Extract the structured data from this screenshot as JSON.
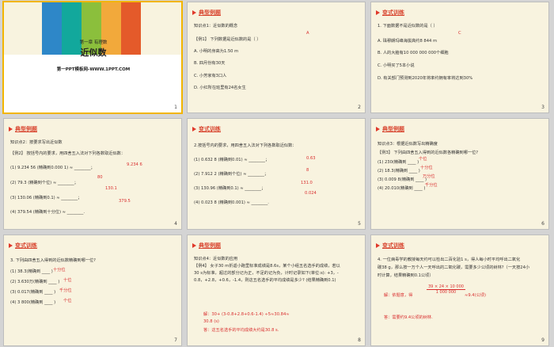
{
  "slides": [
    {
      "num": "1",
      "chapter": "第一章  有理数",
      "title": "近似数",
      "logo": "第一PPT模板网-WWW.1PPT.COM",
      "stripe_colors": [
        "#2e87c8",
        "#12a89c",
        "#8bbf3c",
        "#f2a93b",
        "#e45a2a"
      ]
    },
    {
      "num": "2",
      "header": "典型例题",
      "lines": [
        "知识点1：近似数的概念",
        "【例1】 下列数据是近似数的是（    ）",
        "A. 小明的身高为1.50 m",
        "B. 四月份有30天",
        "C. 小芳家有3口人",
        "D. 小红所在班里有24名女生"
      ],
      "answer": "A"
    },
    {
      "num": "3",
      "header": "变式训练",
      "lines": [
        "1. 下面数据不是近似数的是（    ）",
        "A. 珠穆朗玛峰海拔高约8 844 m",
        "B. 人的大脑有10 000 000 000个细胞",
        "C. 小明买了5本小说",
        "D. 有关部门预测到2020年将率约拥有率将达到30%"
      ],
      "answer": "C"
    },
    {
      "num": "4",
      "header": "典型例题",
      "lines": [
        "知识点2：按要求写出近似数",
        "【例2】 按括号内的要求，用四舍五入法对下列各数取近似数：",
        "(1) 9.234 56 (精确到0.000 1) ≈ ________；",
        "(2) 79.3 (精确到个位) ≈ ________；",
        "(3) 130.06 (精确到0.1) ≈ ________；",
        "(4) 379.54 (精确到十分位) ≈ ________."
      ],
      "answers": [
        "9.234 6",
        "80",
        "130.1",
        "379.5"
      ]
    },
    {
      "num": "5",
      "header": "变式训练",
      "lines": [
        "2.按括号内的要求，用四舍五入法对下列各数取近似数：",
        "(1) 0.632 8 (精确到0.01) ≈ ________；",
        "(2) 7.912 2 (精确到个位) ≈ ________；",
        "(3) 130.96 (精确到0.1) ≈ ________；",
        "(4) 0.023 8 (精确到0.001) ≈ ________."
      ],
      "answers": [
        "0.63",
        "8",
        "131.0",
        "0.024"
      ]
    },
    {
      "num": "6",
      "header": "典型例题",
      "lines": [
        "知识点3：根据近似数写出精确度",
        "【例3】 下列由四舍五入得到的近似数各精确到哪一位?",
        "(1) 230(精确到 ____ )",
        "(2) 18.3(精确到 ____ )",
        "(3) 0.009 8(精确到 ____ )",
        "(4) 20.010(精确到 ____ )"
      ],
      "answers": [
        "个位",
        "十分位",
        "万分位",
        "千分位"
      ]
    },
    {
      "num": "7",
      "header": "变式训练",
      "lines": [
        "3. 下列由四舍五入得到的近似数精确到哪一位?",
        "(1) 38.3(精确到 ____ )",
        "(2) 3.630万(精确到 ____ )",
        "(3) 0.017(精确到 ____ )",
        "(4) 3 800(精确到 ____ )"
      ],
      "answers": [
        "十分位",
        "十位",
        "千分位",
        "个位"
      ]
    },
    {
      "num": "8",
      "header": "典型例题",
      "lines": [
        "知识点4：近似数的应用",
        "【例4】 女子30 m折返小跑里标准成绩是8.6s，某个小组五名选手的成绩，若以",
        "30 s为标准，超过的部分记为正，不足的记为负，计时记录如下(单位:s): +3，-",
        "0.8，+2.8，+0.6，-1.4，则这五名选手的平均成绩是多少? (结果精确到0.1)"
      ],
      "solution": [
        "解：30+ (3-0.8+2.8+0.6-1.4) ÷5≈30.84≈",
        "30.8 (s)",
        "答：这五名选手的平均成绩大约是30.8 s."
      ]
    },
    {
      "num": "9",
      "header": "变式训练",
      "lines": [
        "4. 一位病毒学的教授每天约可以检出二百化验1 s，得人每小时平均呼出二氧化",
        "碳38 g，那么按一万个人一天呼出的二氧化碳，需要多少公顷的树林?（一天按24小",
        "时计算，结果精确到0.1公顷）"
      ],
      "solution": [
        "解：依题意，得",
        "39 × 24 × 10 000",
        "1 000 000",
        "答：需要约9.4公顷的树林."
      ],
      "fraction_tail": "≈9.4(公顷)"
    }
  ]
}
